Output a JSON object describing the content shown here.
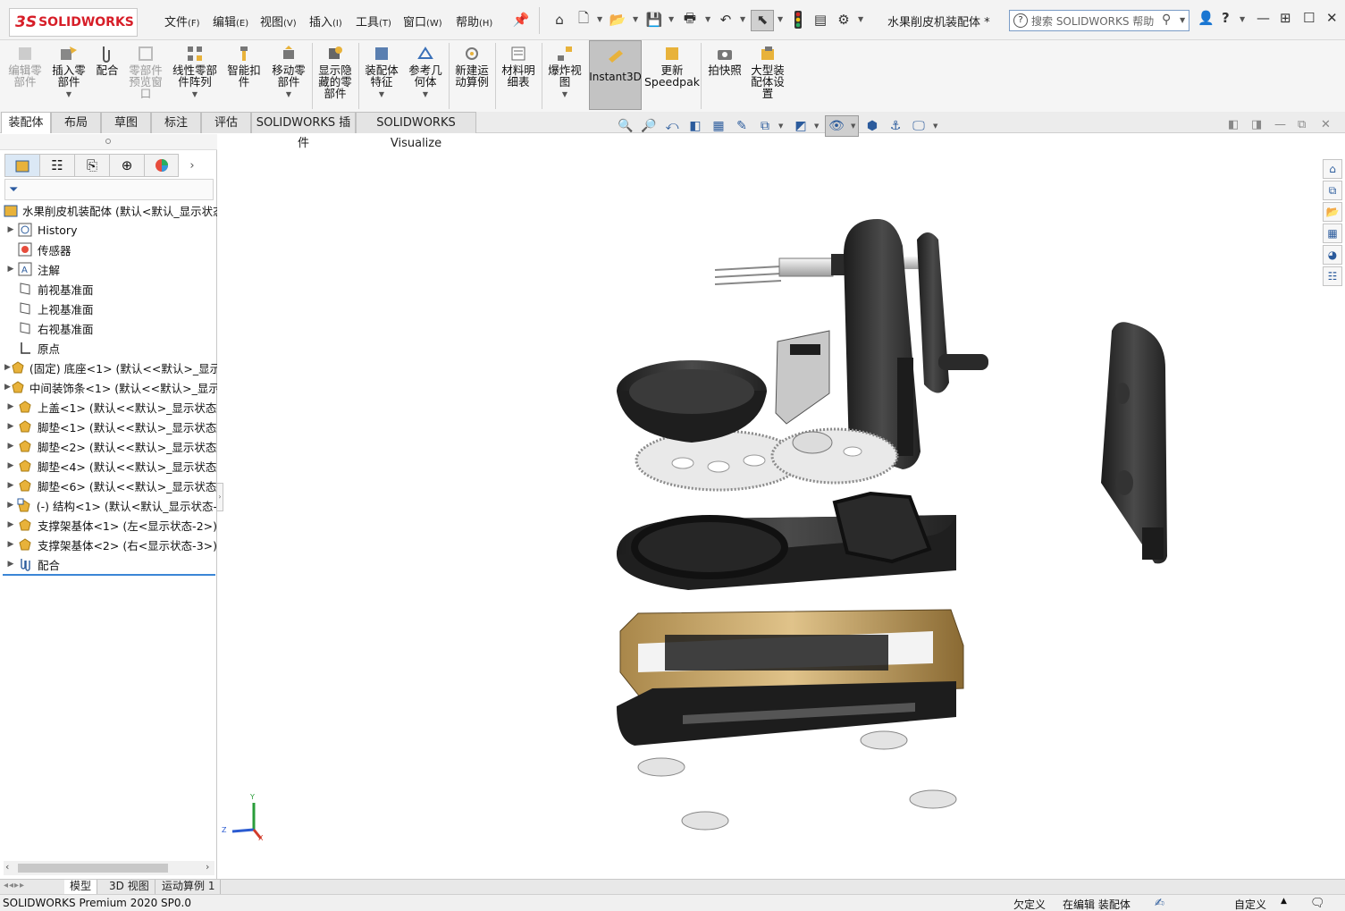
{
  "app": {
    "logo_prefix": "3S",
    "logo_text": "SOLIDWORKS",
    "document_title": "水果削皮机装配体 *"
  },
  "menu": [
    {
      "label": "文件",
      "key": "(F)"
    },
    {
      "label": "编辑",
      "key": "(E)"
    },
    {
      "label": "视图",
      "key": "(V)"
    },
    {
      "label": "插入",
      "key": "(I)"
    },
    {
      "label": "工具",
      "key": "(T)"
    },
    {
      "label": "窗口",
      "key": "(W)"
    },
    {
      "label": "帮助",
      "key": "(H)"
    }
  ],
  "search": {
    "placeholder": "搜索 SOLIDWORKS 帮助"
  },
  "commands": [
    {
      "label": "编辑零\n部件",
      "enabled": false,
      "icon": "edit-component-icon"
    },
    {
      "label": "插入零\n部件",
      "enabled": true,
      "icon": "insert-component-icon"
    },
    {
      "label": "配合",
      "enabled": true,
      "icon": "mate-icon"
    },
    {
      "label": "零部件\n预览窗\n口",
      "enabled": false,
      "icon": "component-preview-icon"
    },
    {
      "label": "线性零部\n件阵列",
      "enabled": true,
      "icon": "linear-pattern-icon"
    },
    {
      "label": "智能扣\n件",
      "enabled": true,
      "icon": "smart-fastener-icon"
    },
    {
      "label": "移动零\n部件",
      "enabled": true,
      "icon": "move-component-icon"
    },
    {
      "label": "显示隐\n藏的零\n部件",
      "enabled": true,
      "icon": "show-hidden-icon"
    },
    {
      "label": "装配体\n特征",
      "enabled": true,
      "icon": "assembly-feature-icon"
    },
    {
      "label": "参考几\n何体",
      "enabled": true,
      "icon": "reference-geometry-icon"
    },
    {
      "label": "新建运\n动算例",
      "enabled": true,
      "icon": "motion-study-icon"
    },
    {
      "label": "材料明\n细表",
      "enabled": true,
      "icon": "bom-icon"
    },
    {
      "label": "爆炸视\n图",
      "enabled": true,
      "icon": "exploded-view-icon"
    },
    {
      "label": "Instant3D",
      "enabled": true,
      "icon": "instant3d-icon"
    },
    {
      "label": "更新\nSpeedpak",
      "enabled": true,
      "icon": "speedpak-icon"
    },
    {
      "label": "拍快照",
      "enabled": true,
      "icon": "snapshot-icon"
    },
    {
      "label": "大型装\n配体设\n置",
      "enabled": true,
      "icon": "large-assembly-icon"
    }
  ],
  "tabs": [
    "装配体",
    "布局",
    "草图",
    "标注",
    "评估",
    "SOLIDWORKS 插件",
    "SOLIDWORKS Visualize"
  ],
  "active_tab": "装配体",
  "tree": {
    "root": "水果削皮机装配体  (默认<默认_显示状态",
    "items": [
      {
        "label": "History",
        "expand": true,
        "icon": "history-icon"
      },
      {
        "label": "传感器",
        "expand": false,
        "icon": "sensor-icon"
      },
      {
        "label": "注解",
        "expand": true,
        "icon": "annotation-icon"
      },
      {
        "label": "前视基准面",
        "expand": false,
        "icon": "plane-icon"
      },
      {
        "label": "上视基准面",
        "expand": false,
        "icon": "plane-icon"
      },
      {
        "label": "右视基准面",
        "expand": false,
        "icon": "plane-icon"
      },
      {
        "label": "原点",
        "expand": false,
        "icon": "origin-icon"
      },
      {
        "label": "(固定) 底座<1> (默认<<默认>_显示",
        "expand": true,
        "icon": "part-icon"
      },
      {
        "label": "中间装饰条<1> (默认<<默认>_显示",
        "expand": true,
        "icon": "part-icon"
      },
      {
        "label": "上盖<1> (默认<<默认>_显示状态",
        "expand": true,
        "icon": "part-icon"
      },
      {
        "label": "脚垫<1> (默认<<默认>_显示状态",
        "expand": true,
        "icon": "part-icon"
      },
      {
        "label": "脚垫<2> (默认<<默认>_显示状态",
        "expand": true,
        "icon": "part-icon"
      },
      {
        "label": "脚垫<4> (默认<<默认>_显示状态",
        "expand": true,
        "icon": "part-icon"
      },
      {
        "label": "脚垫<6> (默认<<默认>_显示状态",
        "expand": true,
        "icon": "part-icon"
      },
      {
        "label": "(-) 结构<1> (默认<默认_显示状态-",
        "expand": true,
        "icon": "subassembly-icon"
      },
      {
        "label": "支撑架基体<1> (左<显示状态-2>)",
        "expand": true,
        "icon": "part-icon"
      },
      {
        "label": "支撑架基体<2> (右<显示状态-3>)",
        "expand": true,
        "icon": "part-icon"
      },
      {
        "label": "配合",
        "expand": true,
        "icon": "mates-icon"
      }
    ]
  },
  "bottom_tabs": [
    "模型",
    "3D 视图",
    "运动算例 1"
  ],
  "active_bottom_tab": "模型",
  "status": {
    "product": "SOLIDWORKS Premium 2020 SP0.0",
    "defined": "欠定义",
    "editing": "在编辑 装配体",
    "units": "自定义"
  },
  "triad": {
    "x": "X",
    "y": "Y",
    "z": "Z"
  },
  "colors": {
    "brand": "#d71e28",
    "part": "#2d2d2d",
    "trim": "#c9a46a",
    "selection": "#3b86d6"
  }
}
